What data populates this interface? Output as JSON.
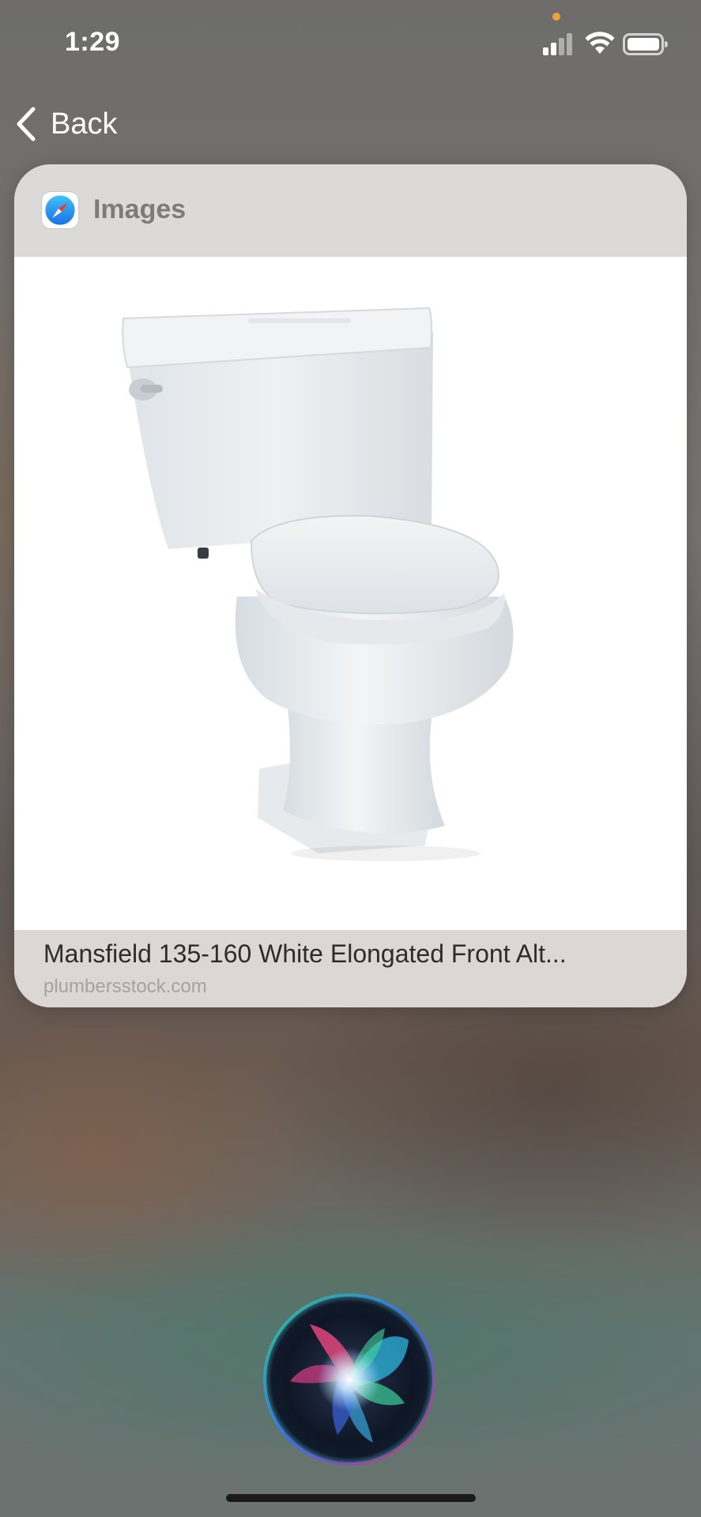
{
  "status_bar": {
    "time": "1:29",
    "signal_icon": "cellular-signal-icon",
    "wifi_icon": "wifi-icon",
    "battery_icon": "battery-icon",
    "privacy_indicator_color": "#f0a13a"
  },
  "nav": {
    "back_label": "Back",
    "back_icon": "chevron-left-icon"
  },
  "card": {
    "app_icon": "safari-compass-icon",
    "header_title": "Images",
    "image_subject": "white two-piece toilet",
    "result_title": "Mansfield 135-160 White Elongated Front Alt...",
    "result_source": "plumbersstock.com"
  },
  "siri": {
    "orb_icon": "siri-orb-icon"
  }
}
